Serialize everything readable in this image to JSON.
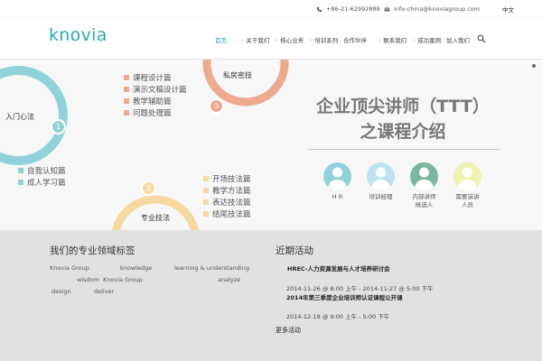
{
  "topbar": {
    "phone": "+86-21-62992888",
    "email": "info-china@knoviagroup.com",
    "language": "中文"
  },
  "header": {
    "logo": "knovia",
    "nav": [
      {
        "label": "首页",
        "active": true,
        "has_dropdown": false
      },
      {
        "label": "关于我们",
        "active": false,
        "has_dropdown": true
      },
      {
        "label": "核心业务",
        "active": false,
        "has_dropdown": true
      },
      {
        "label": "培训系列",
        "active": false,
        "has_dropdown": true
      },
      {
        "label": "合作伙伴",
        "active": false,
        "has_dropdown": false
      },
      {
        "label": "联系我们",
        "active": false,
        "has_dropdown": true
      },
      {
        "label": "成功案例",
        "active": false,
        "has_dropdown": true
      },
      {
        "label": "加入我们",
        "active": false,
        "has_dropdown": false
      }
    ]
  },
  "banner": {
    "circle1": {
      "label": "入门心法",
      "number": "1",
      "color": "#8fd3d8"
    },
    "circle2": {
      "label": "专业技法",
      "number": "2",
      "color": "#f6d9a0"
    },
    "circle3": {
      "label": "私房密技",
      "number": "3",
      "color": "#eea98f"
    },
    "list1": {
      "color": "#eea98f",
      "items": [
        "课程设计篇",
        "演示文稿设计篇",
        "教学辅助篇",
        "问题处理篇"
      ]
    },
    "list2": {
      "color": "#f6d9a0",
      "items": [
        "开场技法篇",
        "教学方法篇",
        "表达技法篇",
        "结尾技法篇"
      ]
    },
    "list3": {
      "color": "#8fd3d8",
      "items": [
        "自我认知篇",
        "成人学习篇"
      ]
    },
    "headline_line1": "企业顶尖讲师（TTT）",
    "headline_line2": "之课程介绍",
    "audience": [
      {
        "label_line1": "H R",
        "label_line2": "",
        "color": "#8fd3d8"
      },
      {
        "label_line1": "培训经理",
        "label_line2": "",
        "color": "#bfe2f2"
      },
      {
        "label_line1": "内部讲师",
        "label_line2": "候选人",
        "color": "#7ab79e"
      },
      {
        "label_line1": "需要演讲",
        "label_line2": "人员",
        "color": "#eef3b0"
      }
    ]
  },
  "footer": {
    "tags_title": "我们的专业领域标签",
    "tags": [
      "Knovia Group",
      "knowledge",
      "learning & understanding",
      "wisdom",
      "Knovia Group",
      "analyze",
      "design",
      "deliver"
    ],
    "events_title": "近期活动",
    "events": [
      {
        "title": "HREC-人力资源发展与人才培养研讨会",
        "date": ""
      },
      {
        "title": "",
        "date": "2014-11-26 @ 8:00 上午 - 2014-11-27 @ 5:00 下午"
      },
      {
        "title": "2014年第三季度企业培训师认证课程公开课",
        "date": ""
      },
      {
        "title": "",
        "date": "2014-12-18 @ 9:00 上午 - 5:00 下午"
      }
    ],
    "more_label": "更多活动"
  }
}
